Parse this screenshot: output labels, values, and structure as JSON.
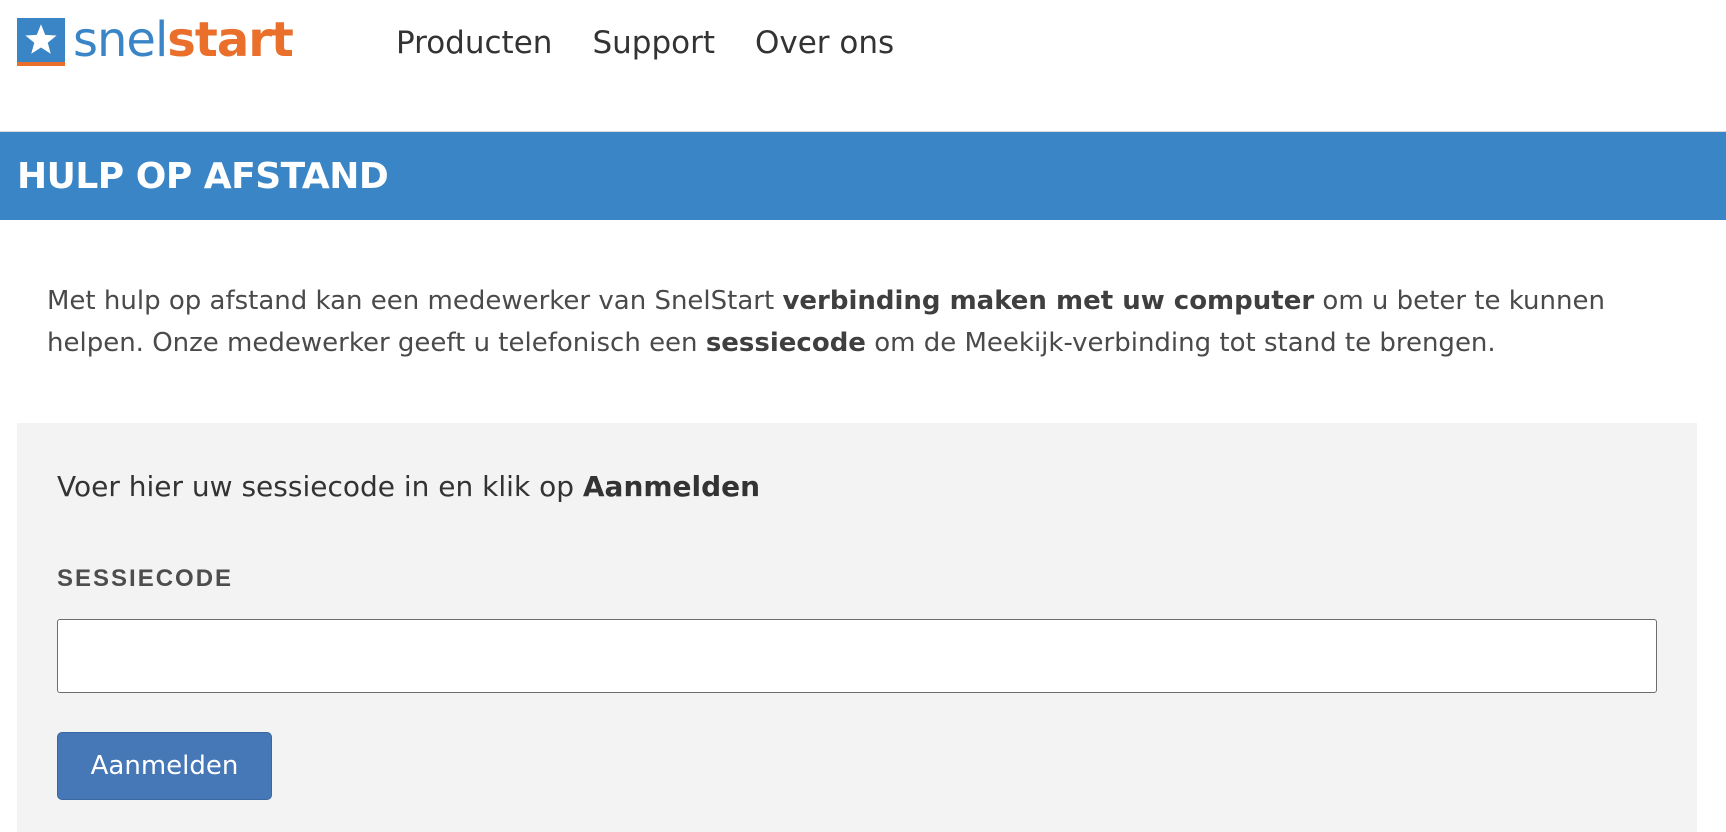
{
  "header": {
    "logo": {
      "part1": "snel",
      "part2": "start",
      "icon": "star-icon"
    },
    "nav": [
      {
        "label": "Producten"
      },
      {
        "label": "Support"
      },
      {
        "label": "Over ons"
      }
    ]
  },
  "banner": {
    "title": "HULP OP AFSTAND"
  },
  "intro": {
    "text_1": "Met hulp op afstand kan een medewerker van SnelStart ",
    "bold_1": "verbinding maken met uw computer",
    "text_2": " om u beter te kunnen helpen. Onze medewerker geeft u telefonisch een ",
    "bold_2": "sessiecode",
    "text_3": " om de Meekijk-verbinding tot stand te brengen."
  },
  "form": {
    "instruction_text": "Voer hier uw sessiecode in en klik op ",
    "instruction_bold": "Aanmelden",
    "field_label": "SESSIECODE",
    "field_value": "",
    "field_placeholder": "",
    "submit_label": "Aanmelden"
  },
  "colors": {
    "brand_blue": "#3a85c6",
    "brand_orange": "#ea6f2b",
    "button_blue": "#4677b6",
    "panel_bg": "#f3f3f3"
  }
}
